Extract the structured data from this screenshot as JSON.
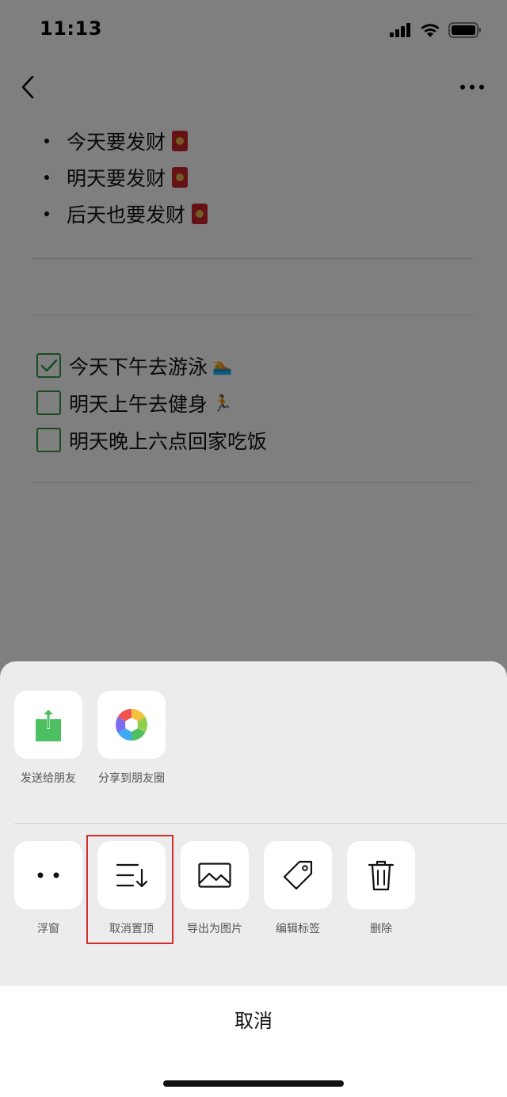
{
  "status_bar": {
    "time": "11:13"
  },
  "note": {
    "bullets": [
      "今天要发财",
      "明天要发财",
      "后天也要发财"
    ],
    "todos": [
      {
        "text": "今天下午去游泳",
        "checked": true,
        "emoji": "🏊"
      },
      {
        "text": "明天上午去健身",
        "checked": false,
        "emoji": "🏃"
      },
      {
        "text": "明天晚上六点回家吃饭",
        "checked": false,
        "emoji": ""
      }
    ]
  },
  "sheet": {
    "share_actions": [
      {
        "label": "发送给朋友",
        "icon": "share-upload-icon"
      },
      {
        "label": "分享到朋友圈",
        "icon": "moments-aperture-icon"
      }
    ],
    "more_actions": [
      {
        "label": "浮窗",
        "icon": "float-window-dots-icon"
      },
      {
        "label": "取消置顶",
        "icon": "unpin-sort-icon"
      },
      {
        "label": "导出为图片",
        "icon": "image-icon"
      },
      {
        "label": "编辑标签",
        "icon": "tag-icon"
      },
      {
        "label": "删除",
        "icon": "trash-icon"
      }
    ],
    "cancel_label": "取消"
  },
  "colors": {
    "accent_green": "#2f9a46",
    "share_green": "#4cbf61",
    "highlight_red": "#d22d2d"
  }
}
